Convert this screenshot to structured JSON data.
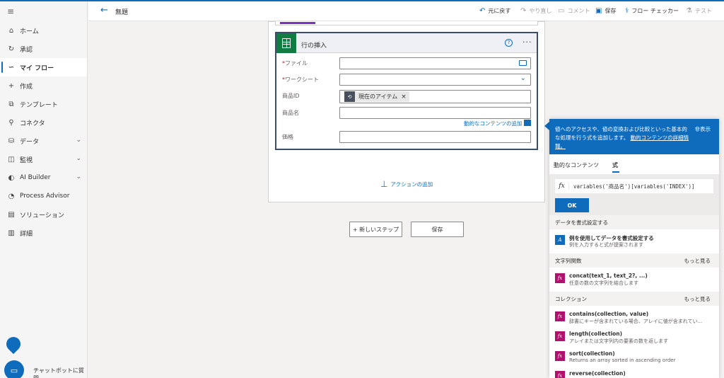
{
  "sidebar": {
    "items": [
      {
        "label": "ホーム",
        "icon": "home-icon"
      },
      {
        "label": "承認",
        "icon": "approvals-icon"
      },
      {
        "label": "マイ フロー",
        "icon": "flow-icon"
      },
      {
        "label": "作成",
        "icon": "plus-icon"
      },
      {
        "label": "テンプレート",
        "icon": "template-icon"
      },
      {
        "label": "コネクタ",
        "icon": "connector-icon"
      },
      {
        "label": "データ",
        "icon": "database-icon"
      },
      {
        "label": "監視",
        "icon": "monitor-icon"
      },
      {
        "label": "AI Builder",
        "icon": "ai-builder-icon"
      },
      {
        "label": "Process Advisor",
        "icon": "process-advisor-icon"
      },
      {
        "label": "ソリューション",
        "icon": "solutions-icon"
      },
      {
        "label": "詳細",
        "icon": "book-icon"
      }
    ],
    "chat_label": "チャットボットに質問"
  },
  "header": {
    "title": "無題",
    "undo": "元に戻す",
    "redo": "やり直し",
    "comment": "コメント",
    "save": "保存",
    "checker": "フロー チェッカー",
    "test": "テスト"
  },
  "action": {
    "title": "行の挿入",
    "fields": [
      {
        "label": "ファイル",
        "required": "*"
      },
      {
        "label": "ワークシート",
        "required": "*"
      },
      {
        "label": "商品ID",
        "required": ""
      },
      {
        "label": "商品名",
        "required": ""
      },
      {
        "label": "価格",
        "required": ""
      }
    ],
    "token_label": "現在のアイテム",
    "dynamic_link": "動的なコンテンツの追加",
    "add_action": "アクションの追加"
  },
  "canvas": {
    "new_step": "+ 新しいステップ",
    "save": "保存"
  },
  "panel": {
    "description": "値へのアクセスや、値の変換および比較といった基本的な処理を行う式を追加します。",
    "description_link": "動的コンテンツの詳細情報。",
    "hide": "非表示",
    "tab_dynamic": "動的なコンテンツ",
    "tab_expression": "式",
    "fx": "fx",
    "expression": "variables('商品名')[variables('INDEX')]",
    "ok": "OK",
    "sections": [
      {
        "title": "データを書式設定する",
        "more": ""
      },
      {
        "title": "文字列関数",
        "more": "もっと見る"
      },
      {
        "title": "コレクション",
        "more": "もっと見る"
      }
    ],
    "functions": [
      {
        "name": "例を使用してデータを書式設定する",
        "desc": "例を入力すると式が提案されます"
      },
      {
        "name": "concat(text_1, text_2?, ...)",
        "desc": "任意の数の文字列を結合します"
      },
      {
        "name": "contains(collection, value)",
        "desc": "辞書にキーが含まれている場合、アレイに値が含まれてい..."
      },
      {
        "name": "length(collection)",
        "desc": "アレイまたは文字列内の要素の数を返します"
      },
      {
        "name": "sort(collection)",
        "desc": "Returns an array sorted in ascending order"
      },
      {
        "name": "reverse(collection)",
        "desc": ""
      }
    ]
  },
  "colors": {
    "accent": "#0f6cbd",
    "excel": "#107c41",
    "function_icon": "#b0116e",
    "required": "#a4262c"
  }
}
